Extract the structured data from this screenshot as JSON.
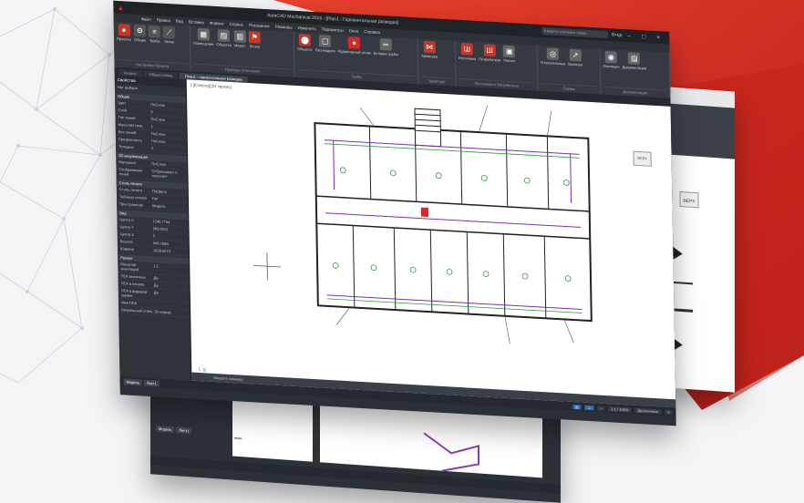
{
  "background": {
    "accent_color": "#d92b25",
    "accent_dark": "#a61c18",
    "network_color": "#c9ccd1"
  },
  "main_window": {
    "title": "AutoCAD Mechanical 2016 - [Plan1 - Горизонтальная разводка]",
    "search_placeholder": "Введите ключевое слово",
    "sign_in": "Вход",
    "menu": [
      "Файл",
      "Правка",
      "Вид",
      "Вставка",
      "Формат",
      "Сервис",
      "Рисование",
      "Размеры",
      "Изменить",
      "Параметры",
      "Окно",
      "Справка"
    ],
    "ribbon_groups": [
      {
        "name": "Настройки Проекта",
        "tools": [
          "Проекты",
          "Общие",
          "Трубы",
          "Уклон"
        ]
      },
      {
        "name": "Приборы Отопления",
        "tools": [
          "Помещения",
          "Объекты",
          "Межэт.",
          "Эл.кат"
        ]
      },
      {
        "name": "Трубы",
        "tools": [
          "Объектн.",
          "Без модуля",
          "Радиаторный стояк",
          "Вставка трубы"
        ]
      },
      {
        "name": "Арматура",
        "tools": [
          "Арматура"
        ]
      },
      {
        "name": "Источники и Потребители",
        "tools": [
          "Источники",
          "Потребители",
          "Расчет"
        ]
      },
      {
        "name": "Сервис",
        "tools": [
          "Отопительные",
          "Выноски"
        ]
      },
      {
        "name": "Документация",
        "tools": [
          "Изоляция",
          "Документация"
        ]
      }
    ],
    "doc_tabs": [
      "Начало",
      "Общая схема",
      "План1 - горизонтальная разводка"
    ],
    "active_tab": "План1 - горизонтальная разводка",
    "view_label": "[-][Сверху][2D-каркас]",
    "navcube_label": "ВЕРХ",
    "command_placeholder": "Введите команду",
    "model_tabs": [
      "Модель",
      "Лист1"
    ],
    "status_scale": "1:1 / 100%",
    "status_units": "Десятичные"
  },
  "properties": {
    "header": "Свойства",
    "selection": "Нет выбора",
    "sections": [
      {
        "title": "Общие",
        "rows": [
          [
            "Цвет",
            "ПоСлою"
          ],
          [
            "Слой",
            "0"
          ],
          [
            "Тип линий",
            "ПоСлою"
          ],
          [
            "Масштаб типа",
            "1"
          ],
          [
            "Вес линий",
            "ПоСлою"
          ],
          [
            "Прозрачность",
            "ПоСлою"
          ],
          [
            "Толщина",
            "0"
          ]
        ]
      },
      {
        "title": "3D визуализация",
        "rows": [
          [
            "Материал",
            "ПоСлою"
          ],
          [
            "Отображение теней",
            "Отбрасывает и получает"
          ]
        ]
      },
      {
        "title": "Стиль печати",
        "rows": [
          [
            "Стиль печати",
            "ПоЦвету"
          ],
          [
            "Таблица стилей",
            "Нет"
          ],
          [
            "Пространство",
            "Модель"
          ]
        ]
      },
      {
        "title": "Вид",
        "rows": [
          [
            "Центр X",
            "1240.7754"
          ],
          [
            "Центр Y",
            "383.8012"
          ],
          [
            "Центр Z",
            "0"
          ],
          [
            "Высота",
            "946.7869"
          ],
          [
            "Ширина",
            "1628.6073"
          ]
        ]
      },
      {
        "title": "Разное",
        "rows": [
          [
            "Масштаб аннотаций",
            "1:1"
          ],
          [
            "ПСК включена",
            "Да"
          ],
          [
            "ПСК в начале",
            "Да"
          ],
          [
            "ПСК в видовом экране",
            "Да"
          ],
          [
            "Имя ПСК",
            ""
          ],
          [
            "Визуальный стиль",
            "2D-каркас"
          ]
        ]
      }
    ]
  },
  "back_window": {
    "navcube_label": "ВЕРХ"
  },
  "bottom_window": {
    "model_tabs": [
      "Модель",
      "Лист1"
    ]
  }
}
